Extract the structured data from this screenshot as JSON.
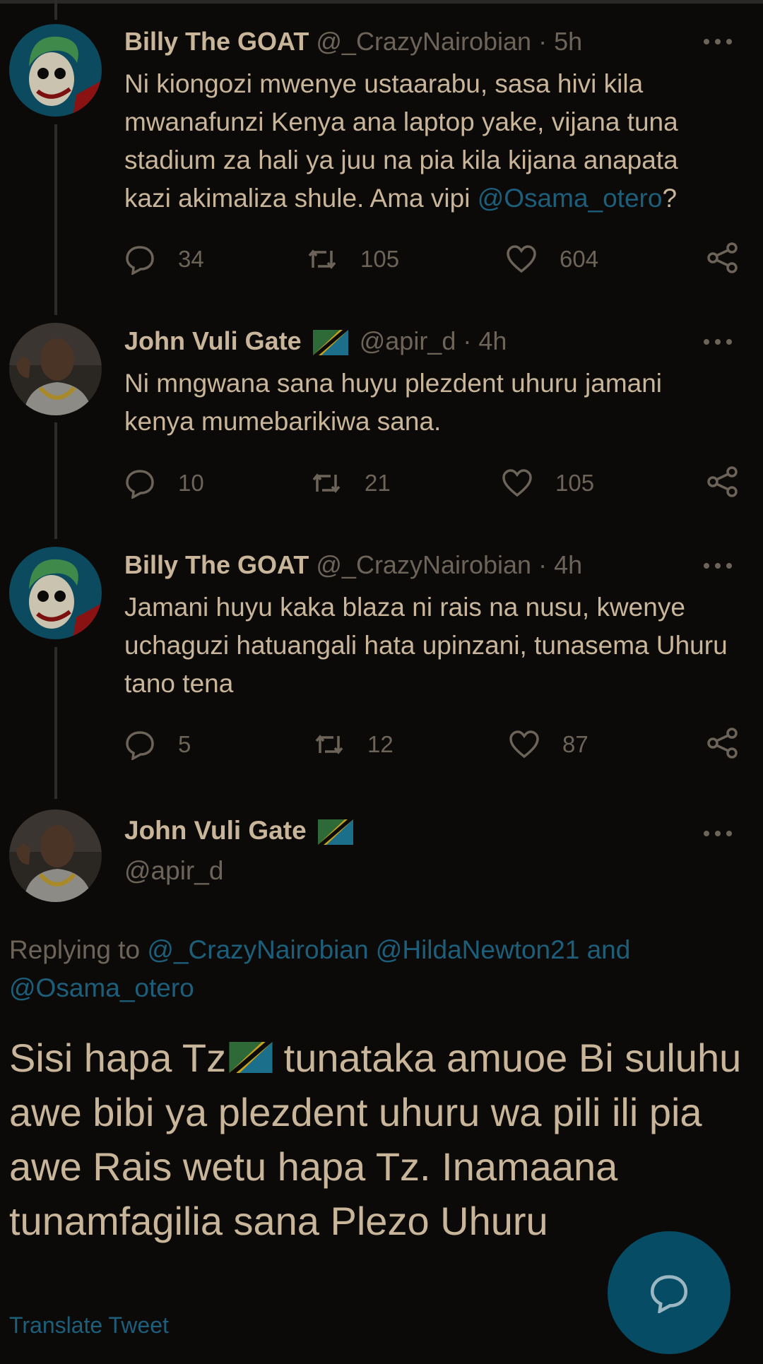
{
  "tweets": [
    {
      "name": "Billy The GOAT",
      "handle": "@_CrazyNairobian",
      "time": "5h",
      "avatar": "joker-avatar",
      "text_before": "Ni kiongozi mwenye ustaarabu, sasa hivi kila mwanafunzi Kenya ana laptop yake, vijana tuna stadium za hali ya juu na pia kila kijana anapata kazi akimaliza shule. Ama vipi ",
      "mention": "@Osama_otero",
      "text_after": "?",
      "replies": "34",
      "retweets": "105",
      "likes": "604"
    },
    {
      "name": "John Vuli Gate",
      "handle": "@apir_d",
      "time": "4h",
      "avatar": "man-avatar",
      "text_before": "Ni mngwana sana huyu plezdent uhuru jamani kenya mumebarikiwa sana.",
      "replies": "10",
      "retweets": "21",
      "likes": "105"
    },
    {
      "name": "Billy The GOAT",
      "handle": "@_CrazyNairobian",
      "time": "4h",
      "avatar": "joker-avatar",
      "text_before": "Jamani huyu kaka blaza ni rais na nusu, kwenye uchaguzi hatuangali hata upinzani, tunasema Uhuru tano tena",
      "replies": "5",
      "retweets": "12",
      "likes": "87"
    }
  ],
  "main": {
    "name": "John Vuli Gate",
    "handle": "@apir_d",
    "replying_prefix": "Replying to ",
    "replying_to": "@_CrazyNairobian @HildaNewton21",
    "replying_and": " and ",
    "replying_last": "@Osama_otero",
    "text_part1": "Sisi hapa Tz",
    "text_part2": " tunataka amuoe Bi suluhu awe bibi ya plezdent uhuru wa pili ili pia awe Rais wetu hapa Tz. Inamaana tunamfagilia sana Plezo Uhuru",
    "translate": "Translate Tweet"
  },
  "colors": {
    "background": "#0b0a09",
    "text": "#c9b69a",
    "muted": "#6d6459",
    "link": "#1d5f7b",
    "fab": "#064c65"
  },
  "icons": [
    "reply-icon",
    "retweet-icon",
    "like-icon",
    "share-icon",
    "more-icon",
    "compose-reply-icon",
    "tanzania-flag-icon"
  ]
}
